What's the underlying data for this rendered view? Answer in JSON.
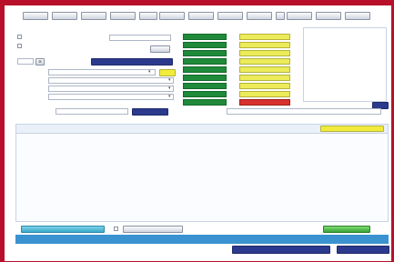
{
  "colors": {
    "frame": "#b8102a",
    "green_button": "#1f8a3a",
    "yellow_button": "#eceb5a",
    "navy_button": "#2b3a8c",
    "teal_button": "#38a8c8",
    "status_bar": "#3a93d0",
    "highlight": "#f1ec3c"
  },
  "icons": {
    "list": "list-icon",
    "dropdown": "chevron-down-icon"
  },
  "toolbar": {
    "buttons": [
      "",
      "",
      "",
      "",
      "",
      "",
      "",
      "",
      "",
      "",
      "",
      "",
      ""
    ]
  },
  "form": {
    "section_label": "",
    "checkbox_1_label": "",
    "checkbox_2_label": "",
    "small_field_value": "",
    "mid_label": "",
    "mid_field_value": "",
    "mid_button": "",
    "navy_header": "",
    "rows": [
      {
        "label": "",
        "value": ""
      },
      {
        "label": "",
        "value": ""
      },
      {
        "label": "",
        "value": ""
      },
      {
        "label": "",
        "value": ""
      }
    ],
    "yellow_button": ""
  },
  "green_panel": {
    "label": "",
    "buttons": [
      "",
      "",
      "",
      "",
      "",
      "",
      "",
      "",
      ""
    ]
  },
  "yellow_panel": {
    "label": "",
    "buttons": [
      "",
      "",
      "",
      "",
      "",
      "",
      "",
      "",
      ""
    ]
  },
  "search": {
    "label": "",
    "value": "",
    "button": "",
    "right_label": "",
    "edge_button": ""
  },
  "list": {
    "header_left": "",
    "header_right": ""
  },
  "actions": {
    "left": "",
    "middle": "",
    "right_text": "",
    "green": ""
  },
  "status": {
    "text": "",
    "left_value": "",
    "mid_value": "",
    "button_1": "",
    "button_2": ""
  }
}
